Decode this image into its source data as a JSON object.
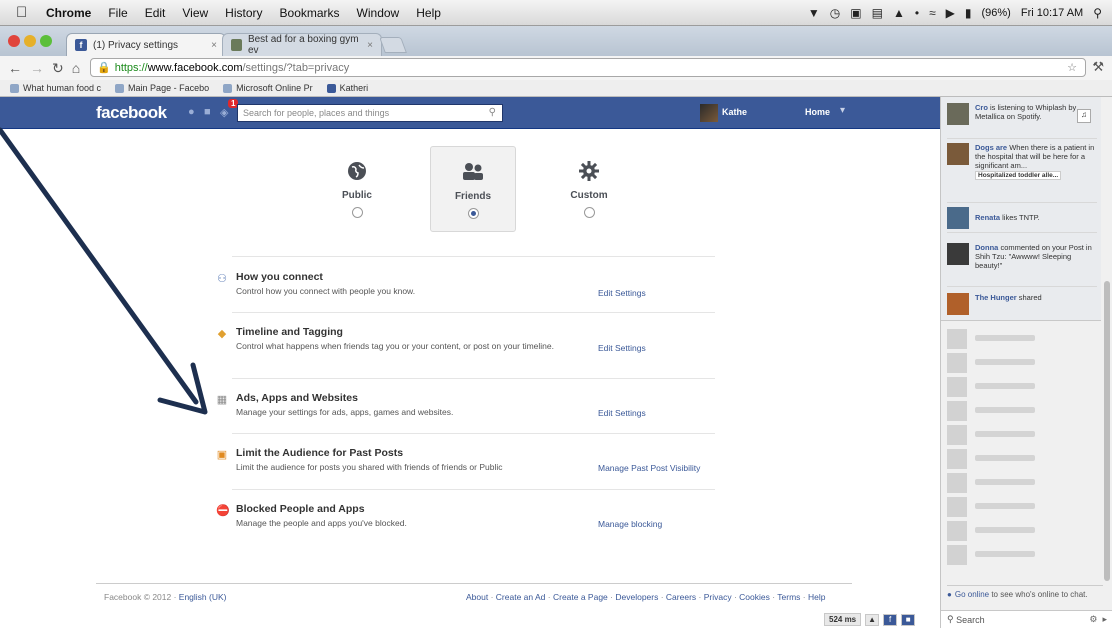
{
  "macmenu": {
    "apple": "",
    "app": "Chrome",
    "items": [
      "File",
      "Edit",
      "View",
      "History",
      "Bookmarks",
      "Window",
      "Help"
    ],
    "battery": "(96%)",
    "clock": "Fri 10:17 AM"
  },
  "tabs": [
    {
      "title": "(1) Privacy settings",
      "active": true
    },
    {
      "title": "Best ad for a boxing gym ev",
      "active": false
    }
  ],
  "address": {
    "https": "https://",
    "domain": "www.facebook.com",
    "path": "/settings/?tab=privacy"
  },
  "bookmarks": [
    "What human food c",
    "Main Page - Facebo",
    "Microsoft Online Pr",
    "Katheri"
  ],
  "fb": {
    "logo": "facebook",
    "notif_count": "1",
    "search_placeholder": "Search for people, places and things",
    "user_name": "Kathe",
    "home": "Home"
  },
  "audience": [
    {
      "label": "Public",
      "icon": "globe-icon",
      "selected": false
    },
    {
      "label": "Friends",
      "icon": "friends-icon",
      "selected": true
    },
    {
      "label": "Custom",
      "icon": "gear-icon",
      "selected": false
    }
  ],
  "sections": [
    {
      "title": "How you connect",
      "desc": "Control how you connect with people you know.",
      "link": "Edit Settings",
      "icon": "people-icon"
    },
    {
      "title": "Timeline and Tagging",
      "desc": "Control what happens when friends tag you or your content, or post on your timeline.",
      "link": "Edit Settings",
      "icon": "tag-icon"
    },
    {
      "title": "Ads, Apps and Websites",
      "desc": "Manage your settings for ads, apps, games and websites.",
      "link": "Edit Settings",
      "icon": "apps-icon"
    },
    {
      "title": "Limit the Audience for Past Posts",
      "desc": "Limit the audience for posts you shared with friends of friends or Public",
      "link": "Manage Past Post Visibility",
      "icon": "lock-icon"
    },
    {
      "title": "Blocked People and Apps",
      "desc": "Manage the people and apps you've blocked.",
      "link": "Manage blocking",
      "icon": "block-icon"
    }
  ],
  "footer": {
    "copyright": "Facebook © 2012 · ",
    "language": "English (UK)",
    "links": [
      "About",
      "Create an Ad",
      "Create a Page",
      "Developers",
      "Careers",
      "Privacy",
      "Cookies",
      "Terms",
      "Help"
    ],
    "ms": "524 ms"
  },
  "ticker": [
    {
      "name": "Cro",
      "text": "is listening to Whiplash by Metallica on Spotify."
    },
    {
      "name": "Dogs are",
      "text": "When there is a patient in the hospital that will be here for a significant am...",
      "sub": "Hospitalized toddler alle..."
    },
    {
      "name": "Renata",
      "text": "likes TNTP."
    },
    {
      "name": "Donna",
      "text": "commented on your Post in Shih Tzu: \"Awwww! Sleeping beauty!\""
    },
    {
      "name": "The Hunger",
      "text": "shared"
    }
  ],
  "chat": {
    "go_online_link": "Go online",
    "go_online_text": "to see who's online to chat.",
    "search": "Search"
  },
  "colors": {
    "fb_blue": "#3b5998",
    "arrow": "#1d2f4f"
  }
}
